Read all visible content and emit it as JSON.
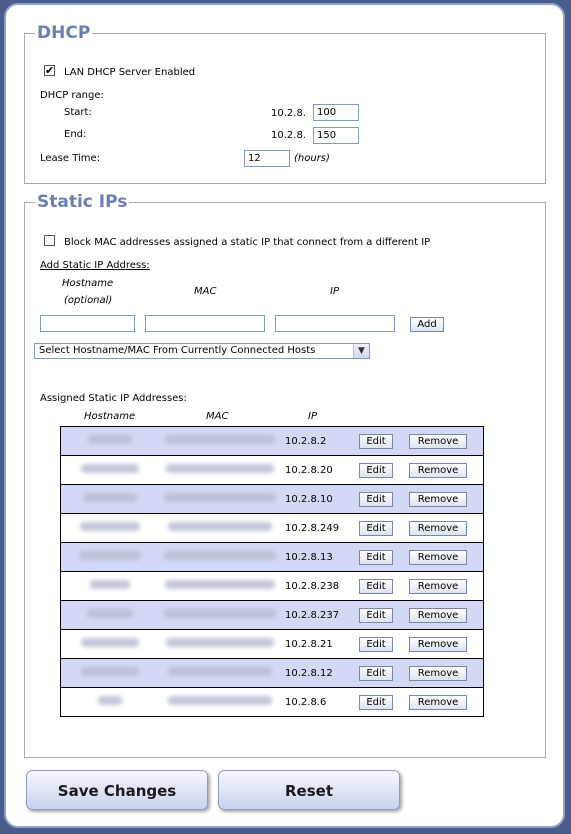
{
  "dhcp": {
    "legend": "DHCP",
    "server_enabled_label": "LAN DHCP Server Enabled",
    "server_enabled": true,
    "range_label": "DHCP range:",
    "start_label": "Start:",
    "start_prefix": "10.2.8.",
    "start_value": "100",
    "end_label": "End:",
    "end_prefix": "10.2.8.",
    "end_value": "150",
    "lease_label": "Lease Time:",
    "lease_value": "12",
    "lease_units": "(hours)"
  },
  "static": {
    "legend": "Static IPs",
    "block_label": "Block MAC addresses assigned a static IP that connect from a different IP",
    "block_checked": false,
    "add_title": "Add Static IP Address:",
    "col_hostname": "Hostname",
    "col_optional": "(optional)",
    "col_mac": "MAC",
    "col_ip": "IP",
    "add_button": "Add",
    "select_label": "Select Hostname/MAC From Currently Connected Hosts",
    "assigned_title": "Assigned Static IP Addresses:",
    "table_hostname": "Hostname",
    "table_mac": "MAC",
    "table_ip": "IP",
    "edit_label": "Edit",
    "remove_label": "Remove",
    "rows": [
      {
        "ip": "10.2.8.2"
      },
      {
        "ip": "10.2.8.20"
      },
      {
        "ip": "10.2.8.10"
      },
      {
        "ip": "10.2.8.249"
      },
      {
        "ip": "10.2.8.13"
      },
      {
        "ip": "10.2.8.238"
      },
      {
        "ip": "10.2.8.237"
      },
      {
        "ip": "10.2.8.21"
      },
      {
        "ip": "10.2.8.12"
      },
      {
        "ip": "10.2.8.6"
      }
    ]
  },
  "actions": {
    "save": "Save Changes",
    "reset": "Reset"
  }
}
